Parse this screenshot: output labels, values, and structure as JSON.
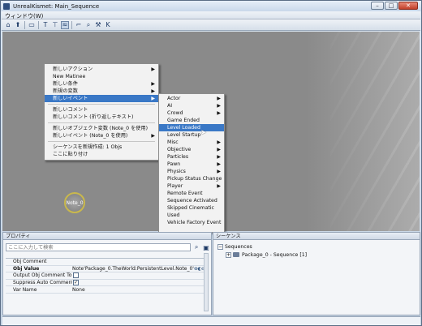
{
  "window": {
    "title": "UnrealKismet: Main_Sequence"
  },
  "window_buttons": {
    "minimize": "–",
    "maximize": "□",
    "close": "✕"
  },
  "menubar": {
    "items": [
      "ウィンドウ(W)"
    ]
  },
  "toolbar": {
    "icons": [
      "home-icon",
      "parent-sequence-icon",
      "open-icon",
      "toggle-t-icon",
      "toggle-tf-icon",
      "comment-icon",
      "cursor-icon",
      "search-icon",
      "tools-icon",
      "k-icon"
    ]
  },
  "canvas": {
    "note_node_label": "Note_0"
  },
  "context_menu": {
    "items": [
      {
        "label": "新しいアクション",
        "submenu": true
      },
      {
        "label": "New Matinee",
        "submenu": false
      },
      {
        "label": "新しい条件",
        "submenu": true
      },
      {
        "label": "新規の変数",
        "submenu": true
      },
      {
        "label": "新しいイベント",
        "submenu": true,
        "highlighted": true
      },
      {
        "label": "新しいコメント",
        "submenu": false
      },
      {
        "label": "新しいコメント (折り返しテキスト)",
        "submenu": false
      },
      {
        "label": "新しいオブジェクト変数 (Note_0 を使用)",
        "submenu": false
      },
      {
        "label": "新しいイベント (Note_0 を使用)",
        "submenu": true
      },
      {
        "label": "シーケンスを新規作成: 1 Objs",
        "submenu": false
      },
      {
        "label": "ここに貼り付け",
        "submenu": false
      }
    ]
  },
  "event_submenu": {
    "items": [
      {
        "label": "Actor",
        "submenu": true
      },
      {
        "label": "AI",
        "submenu": true
      },
      {
        "label": "Crowd",
        "submenu": true
      },
      {
        "label": "Game Ended",
        "submenu": false
      },
      {
        "label": "Level Loaded",
        "submenu": false,
        "highlighted": true
      },
      {
        "label": "Level Startup",
        "submenu": false
      },
      {
        "label": "Misc",
        "submenu": true
      },
      {
        "label": "Objective",
        "submenu": true
      },
      {
        "label": "Particles",
        "submenu": true
      },
      {
        "label": "Pawn",
        "submenu": true
      },
      {
        "label": "Physics",
        "submenu": true
      },
      {
        "label": "Pickup Status Change",
        "submenu": false
      },
      {
        "label": "Player",
        "submenu": true
      },
      {
        "label": "Remote Event",
        "submenu": false
      },
      {
        "label": "Sequence Activated",
        "submenu": false
      },
      {
        "label": "Skipped Cinematic",
        "submenu": false
      },
      {
        "label": "Used",
        "submenu": false
      },
      {
        "label": "Vehicle Factory Event",
        "submenu": false
      }
    ]
  },
  "properties_panel": {
    "title": "プロパティ",
    "search": {
      "value": "",
      "placeholder": "ここに入力して検索"
    },
    "rows": [
      {
        "name": "Obj Comment",
        "value": "",
        "bold": false,
        "checkbox": null
      },
      {
        "name": "Obj Value",
        "value": "Note'Package_0.TheWorld:PersistentLevel.Note_0'",
        "bold": true,
        "checkbox": null
      },
      {
        "name": "Output Obj Comment To S",
        "value": "",
        "bold": false,
        "checkbox": false
      },
      {
        "name": "Suppress Auto Comment?",
        "value": "",
        "bold": false,
        "checkbox": true
      },
      {
        "name": "Var Name",
        "value": "None",
        "bold": false,
        "checkbox": null
      }
    ]
  },
  "sequences_panel": {
    "title": "シーケンス",
    "tree": [
      {
        "label": "Sequences",
        "depth": 0,
        "expanded": true
      },
      {
        "label": "Package_0 - Sequence [1]",
        "depth": 1,
        "expanded": false
      }
    ]
  }
}
